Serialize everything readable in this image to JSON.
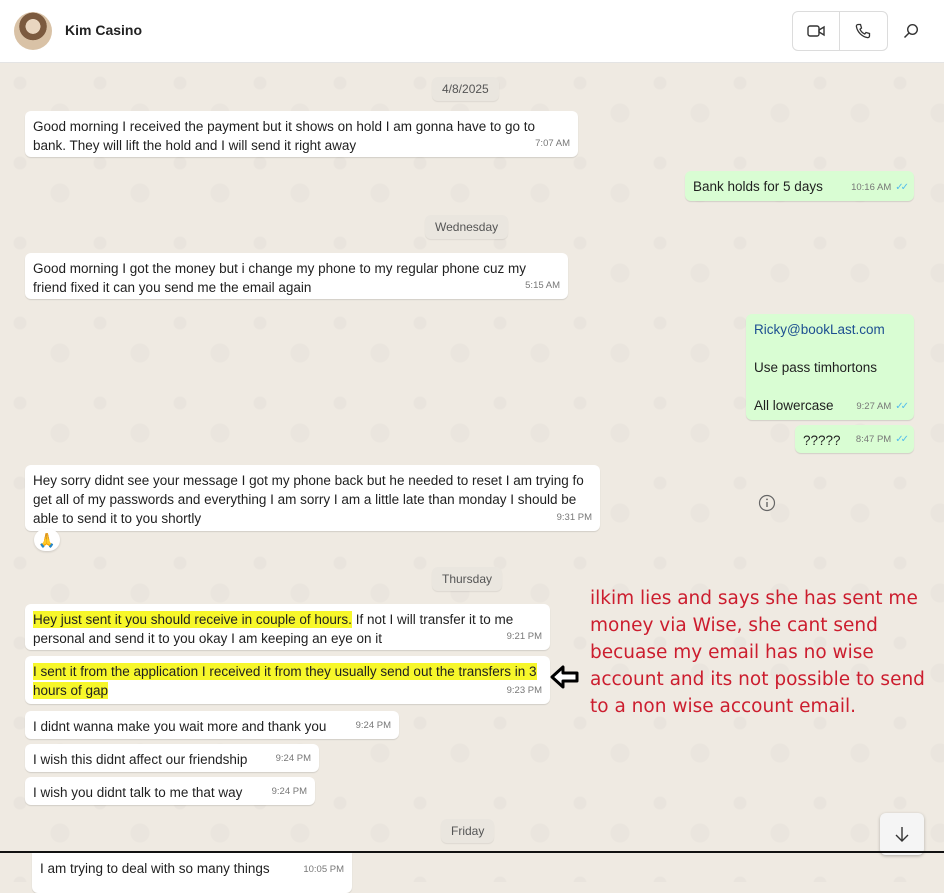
{
  "header": {
    "contact_name": "Kim Casino",
    "avatar_icon": "contact-avatar",
    "video_call_icon": "video-camera-icon",
    "voice_call_icon": "phone-icon",
    "search_icon": "search-icon"
  },
  "dates": [
    "4/8/2025",
    "Wednesday",
    "Thursday",
    "Friday"
  ],
  "messages": [
    {
      "dir": "in",
      "text": "Good morning I received the payment but it shows on hold I am gonna have to go to bank. They will lift the hold and I will send it right away",
      "time": "7:07 AM"
    },
    {
      "dir": "out",
      "text": "Bank holds for 5 days",
      "time": "10:16 AM",
      "read": true
    },
    {
      "dir": "in",
      "text": "Good morning I got the money but i change my phone to my regular phone cuz my friend fixed it can you send me the email again",
      "time": "5:15 AM"
    },
    {
      "dir": "out",
      "lines": [
        "Ricky@bookLast.com",
        "Use pass  timhortons",
        "All lowercase"
      ],
      "time": "9:27 AM",
      "read": true
    },
    {
      "dir": "out",
      "text": "?????",
      "time": "8:47 PM",
      "read": true
    },
    {
      "dir": "in",
      "text": "Hey sorry didnt see your message I got my phone back but he needed to reset I am trying fo get all of my passwords and everything I am sorry I am a little late than monday I should be able to send it to you shortly",
      "time": "9:31 PM",
      "reaction": "🙏"
    },
    {
      "dir": "in",
      "highlight": "Hey just sent it you should receive in couple of hours.",
      "text": " If not I will transfer it to me personal and send it to you okay I am keeping an eye on it",
      "time": "9:21 PM"
    },
    {
      "dir": "in",
      "highlight": "I sent it from the application I received it from they usually send out the transfers in 3 hours of gap",
      "time": "9:23 PM"
    },
    {
      "dir": "in",
      "text": "I didnt wanna make you wait more and thank you",
      "time": "9:24 PM"
    },
    {
      "dir": "in",
      "text": "I wish this didnt affect our friendship",
      "time": "9:24 PM"
    },
    {
      "dir": "in",
      "text": "I wish you didnt talk to me that way",
      "time": "9:24 PM"
    },
    {
      "dir": "in",
      "text": "I am trying to deal with so many things",
      "time": "10:05 PM"
    }
  ],
  "annotation": {
    "text": "ilkim lies and says she has sent me money via Wise, she cant send becuase my email has no wise account and its not possible to send to a non wise account email.",
    "color": "#cc1d2e",
    "arrow_icon": "left-arrow-icon"
  },
  "scroll_down_icon": "arrow-down-icon",
  "info_icon": "info-icon",
  "colors": {
    "incoming": "#ffffff",
    "outgoing": "#d9fdd3",
    "highlight": "#f7f72a",
    "read_ticks": "#53bdeb"
  }
}
